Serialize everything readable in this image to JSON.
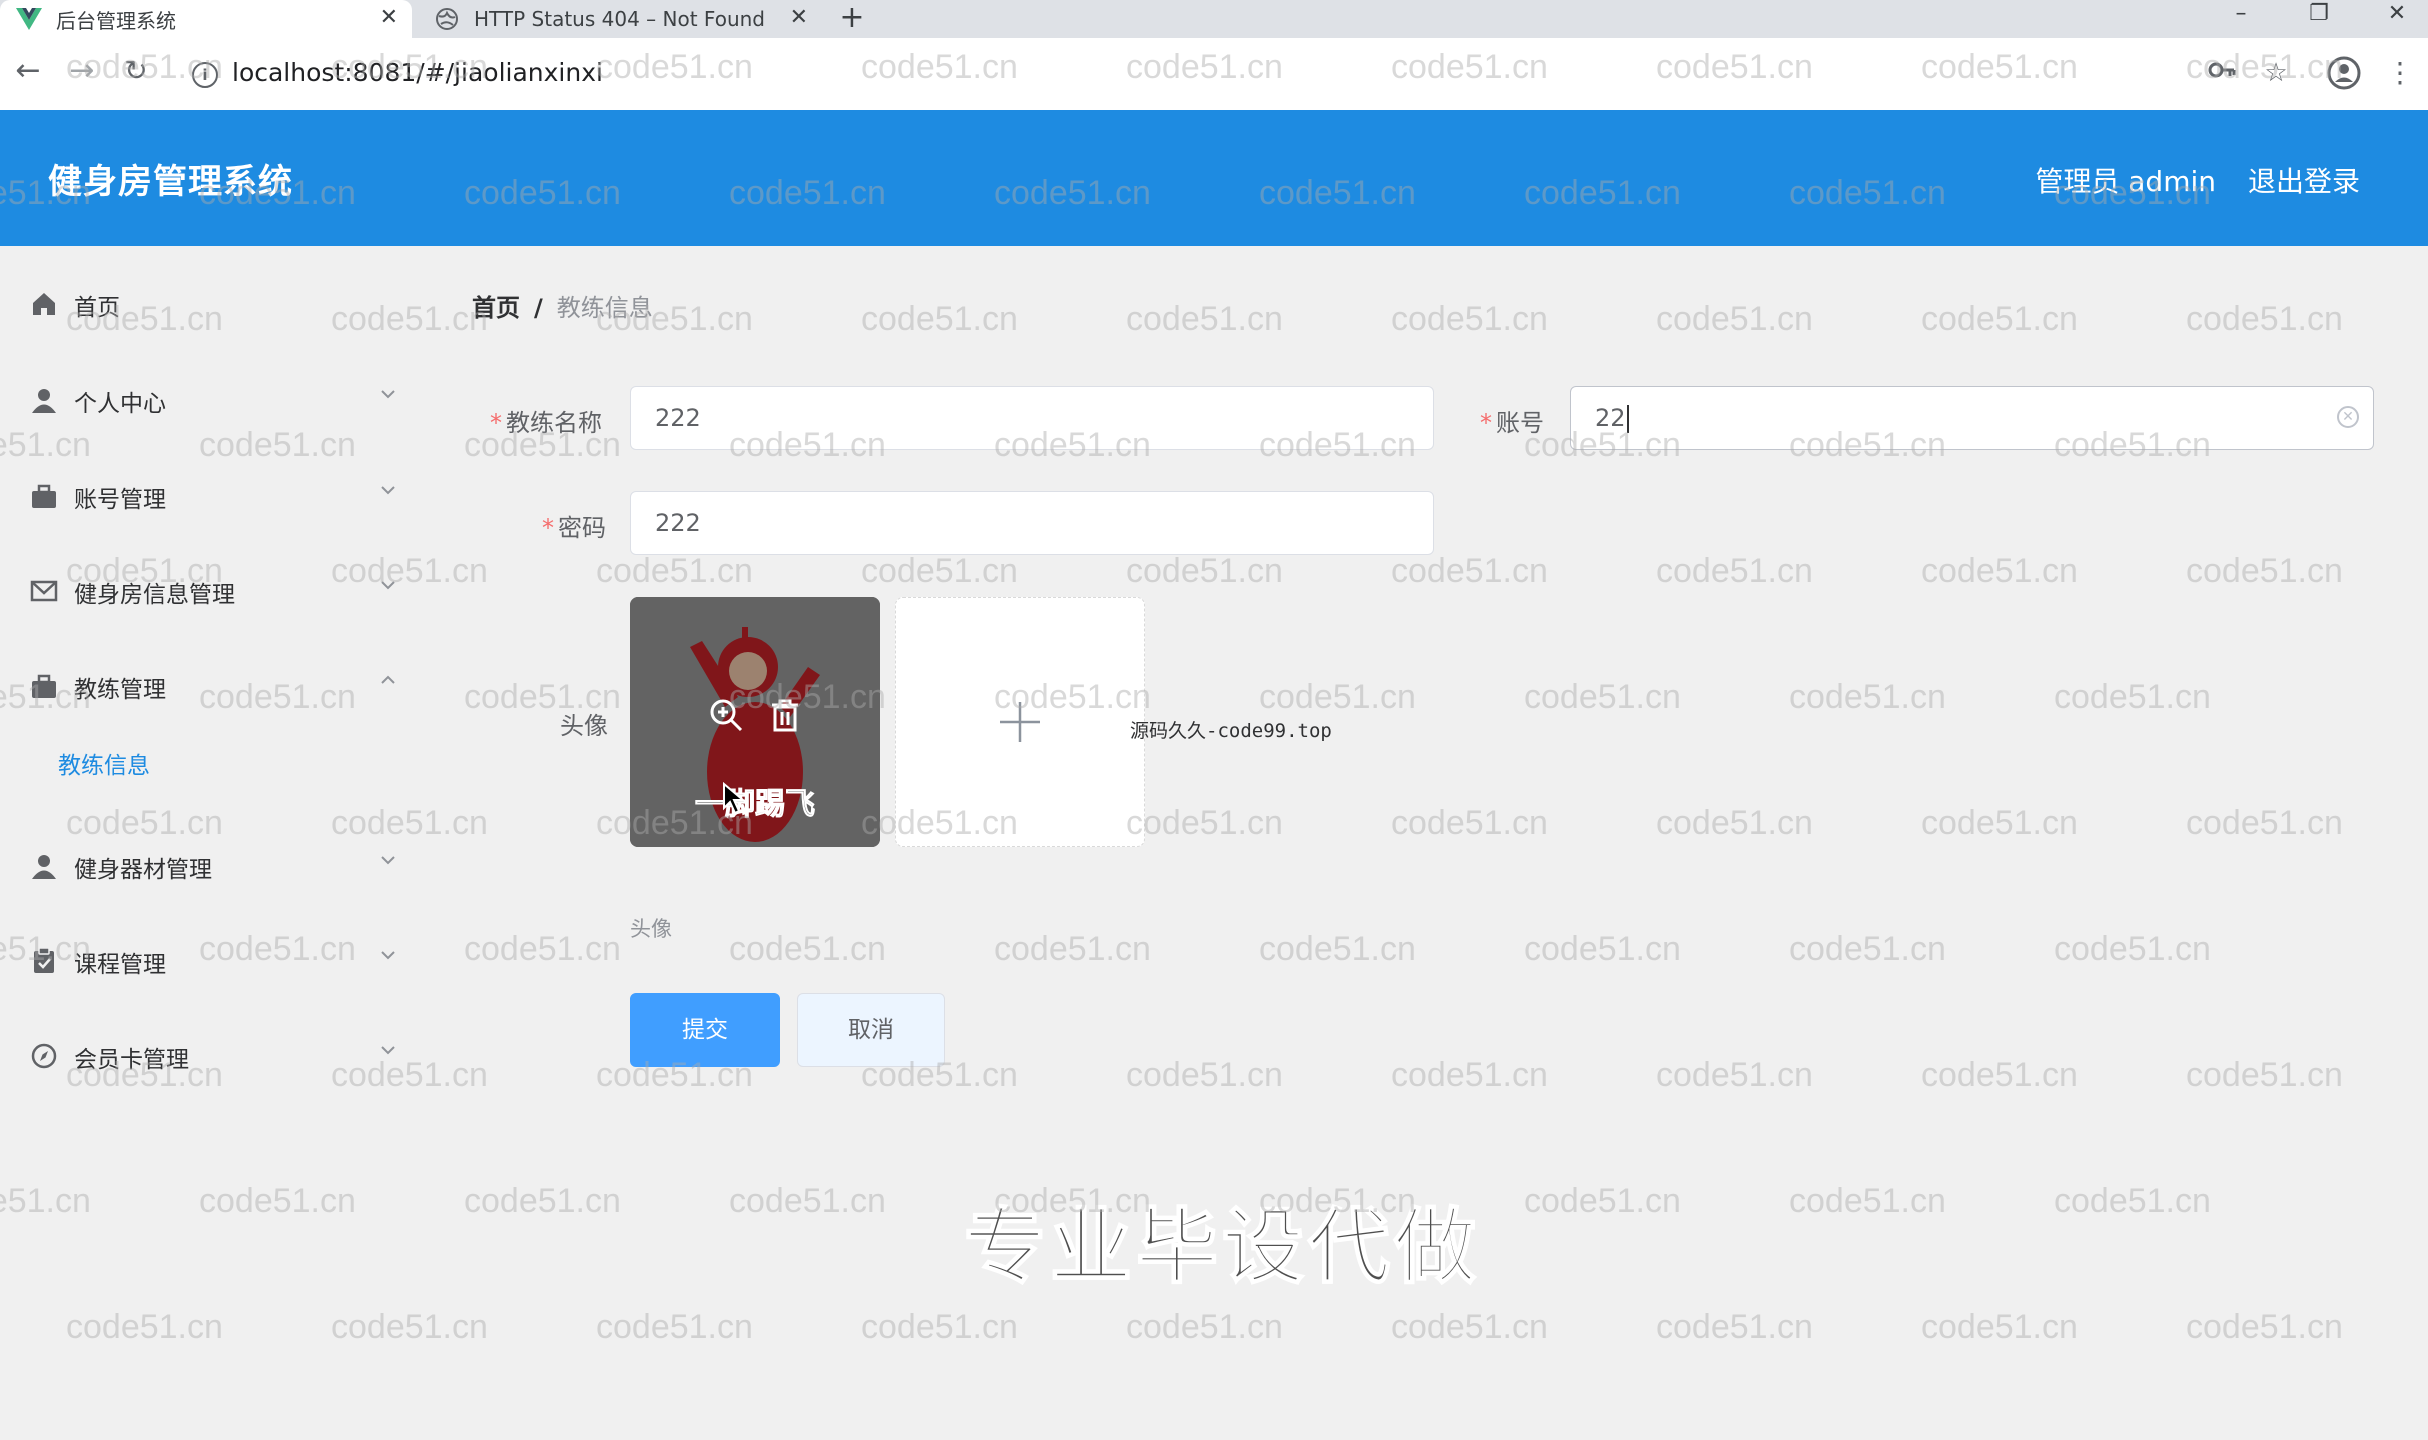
{
  "browser": {
    "tabs": [
      {
        "title": "后台管理系统",
        "active": true
      },
      {
        "title": "HTTP Status 404 – Not Found",
        "active": false
      }
    ],
    "url": "localhost:8081/#/jiaolianxinxi"
  },
  "header": {
    "app_title": "健身房管理系统",
    "admin_label": "管理员 admin",
    "logout_label": "退出登录",
    "color": "#1e8be1"
  },
  "sidebar": {
    "items": [
      {
        "label": "首页",
        "icon": "home-icon"
      },
      {
        "label": "个人中心",
        "icon": "user-icon"
      },
      {
        "label": "账号管理",
        "icon": "suitcase-icon"
      },
      {
        "label": "健身房信息管理",
        "icon": "mail-icon"
      },
      {
        "label": "教练管理",
        "icon": "suitcase-icon",
        "expanded": true
      },
      {
        "label": "健身器材管理",
        "icon": "user-icon"
      },
      {
        "label": "课程管理",
        "icon": "clipboard-icon"
      },
      {
        "label": "会员卡管理",
        "icon": "compass-icon"
      }
    ],
    "sub_item": "教练信息"
  },
  "breadcrumb": {
    "home": "首页",
    "separator": "/",
    "current": "教练信息"
  },
  "form": {
    "coach_name_label": "教练名称",
    "coach_name_value": "222",
    "account_label": "账号",
    "account_value": "22",
    "password_label": "密码",
    "password_value": "222",
    "avatar_label": "头像",
    "avatar_caption": "一脚踢飞",
    "avatar_hint": "头像",
    "submit_label": "提交",
    "cancel_label": "取消",
    "required_mark": "*"
  },
  "overlay": {
    "source_note": "源码久久-code99.top",
    "promo": "专业毕设代做",
    "watermark": "code51.cn"
  }
}
